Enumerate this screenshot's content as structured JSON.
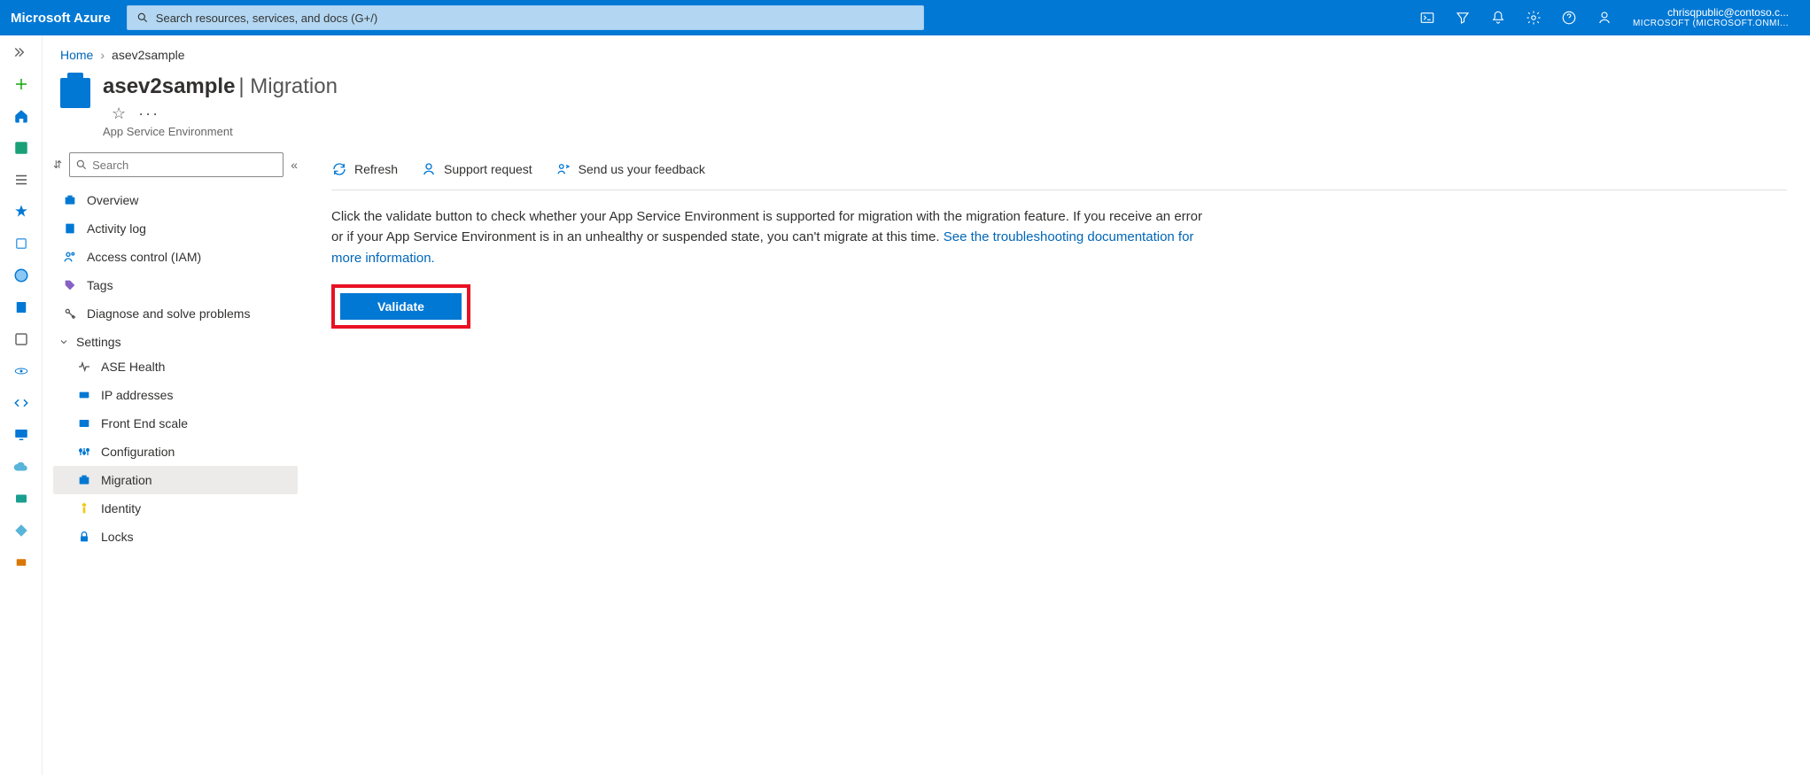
{
  "topbar": {
    "brand": "Microsoft Azure",
    "search_placeholder": "Search resources, services, and docs (G+/)",
    "account_email": "chrisqpublic@contoso.c...",
    "account_directory": "MICROSOFT (MICROSOFT.ONMI..."
  },
  "breadcrumb": {
    "home": "Home",
    "resource": "asev2sample"
  },
  "header": {
    "resource_name": "asev2sample",
    "page_name": "Migration",
    "kind": "App Service Environment"
  },
  "nav": {
    "search_placeholder": "Search",
    "items": {
      "overview": "Overview",
      "activity": "Activity log",
      "iam": "Access control (IAM)",
      "tags": "Tags",
      "diagnose": "Diagnose and solve problems",
      "settings": "Settings",
      "ase_health": "ASE Health",
      "ip_addresses": "IP addresses",
      "frontend": "Front End scale",
      "configuration": "Configuration",
      "migration": "Migration",
      "identity": "Identity",
      "locks": "Locks"
    }
  },
  "toolbar": {
    "refresh": "Refresh",
    "support": "Support request",
    "feedback": "Send us your feedback"
  },
  "main": {
    "info_text": "Click the validate button to check whether your App Service Environment is supported for migration with the migration feature. If you receive an error or if your App Service Environment is in an unhealthy or suspended state, you can't migrate at this time. ",
    "link_text": "See the troubleshooting documentation for more information.",
    "validate_button": "Validate"
  }
}
